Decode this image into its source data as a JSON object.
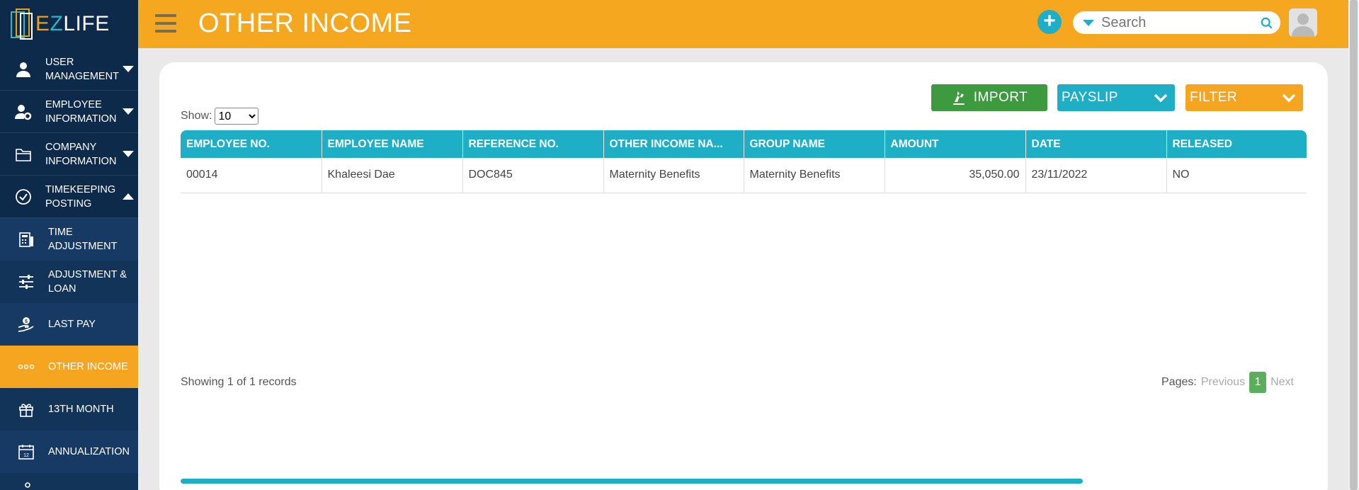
{
  "app": {
    "logo_prefix_e": "E",
    "logo_prefix_z": "Z",
    "logo_suffix": "LIFE"
  },
  "header": {
    "title": "OTHER INCOME",
    "search_placeholder": "Search",
    "add_label": "+"
  },
  "sidebar": {
    "items": [
      {
        "label": "USER MANAGEMENT",
        "icon": "user-icon",
        "caret": "down"
      },
      {
        "label": "EMPLOYEE INFORMATION",
        "icon": "employee-settings-icon",
        "caret": "down"
      },
      {
        "label": "COMPANY INFORMATION",
        "icon": "folder-icon",
        "caret": "down"
      },
      {
        "label": "TIMEKEEPING POSTING",
        "icon": "check-circle-icon",
        "caret": "up"
      },
      {
        "label": "TIME ADJUSTMENT",
        "icon": "calculator-icon"
      },
      {
        "label": "ADJUSTMENT & LOAN",
        "icon": "sliders-icon"
      },
      {
        "label": "LAST PAY",
        "icon": "hand-coin-icon"
      },
      {
        "label": "OTHER INCOME",
        "icon": "dots-icon",
        "active": true
      },
      {
        "label": "13TH MONTH",
        "icon": "gift-icon"
      },
      {
        "label": "ANNUALIZATION",
        "icon": "calendar-icon",
        "calendar_day": "12"
      }
    ]
  },
  "toolbar": {
    "show_label": "Show:",
    "show_value": "10",
    "import_label": "IMPORT",
    "payslip_label": "PAYSLIP",
    "filter_label": "FILTER"
  },
  "table": {
    "columns": [
      "EMPLOYEE NO.",
      "EMPLOYEE NAME",
      "REFERENCE NO.",
      "OTHER INCOME NA...",
      "GROUP NAME",
      "AMOUNT",
      "DATE",
      "RELEASED"
    ],
    "rows": [
      [
        "00014",
        "Khaleesi Dae",
        "DOC845",
        "Maternity Benefits",
        "Maternity Benefits",
        "35,050.00",
        "23/11/2022",
        "NO"
      ]
    ]
  },
  "footer": {
    "records_text": "Showing 1 of 1 records",
    "pages_label": "Pages:",
    "previous_label": "Previous",
    "current_page": "1",
    "next_label": "Next"
  },
  "colors": {
    "accent_orange": "#f5a81f",
    "accent_teal": "#1eafc7",
    "sidebar_navy": "#123459",
    "import_green": "#3d9a3f"
  }
}
